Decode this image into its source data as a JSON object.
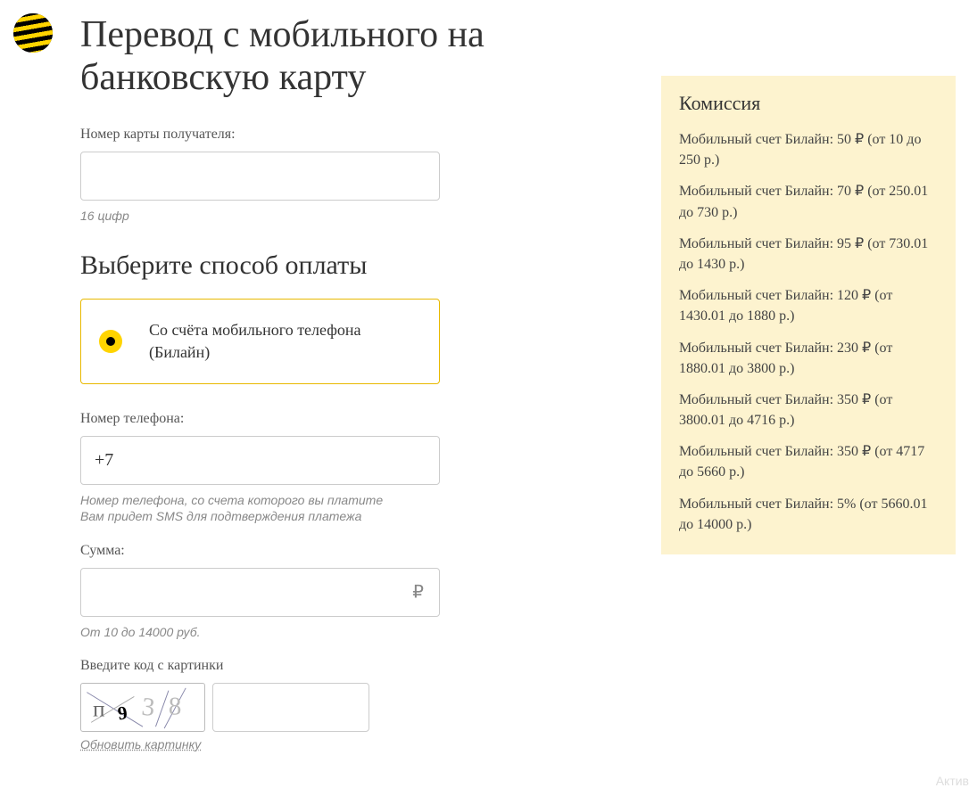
{
  "page_title": "Перевод с мобильного на банковскую карту",
  "card": {
    "label": "Номер карты получателя:",
    "value": "",
    "hint": "16 цифр"
  },
  "payment_method": {
    "heading": "Выберите способ оплаты",
    "option_label": "Со счёта мобильного телефона (Билайн)"
  },
  "phone": {
    "label": "Номер телефона:",
    "value": "+7",
    "hint_line1": "Номер телефона, со счета которого вы платите",
    "hint_line2": "Вам придет SMS для подтверждения платежа"
  },
  "amount": {
    "label": "Сумма:",
    "value": "",
    "currency": "₽",
    "hint": "От 10 до 14000 руб."
  },
  "captcha": {
    "label": "Введите код с картинки",
    "value": "",
    "refresh": "Обновить картинку"
  },
  "commission": {
    "title": "Комиссия",
    "items": [
      "Мобильный счет Билайн: 50 ₽ (от 10 до 250 р.)",
      "Мобильный счет Билайн: 70 ₽ (от 250.01 до 730 р.)",
      "Мобильный счет Билайн: 95 ₽ (от 730.01 до 1430 р.)",
      "Мобильный счет Билайн: 120 ₽ (от 1430.01 до 1880 р.)",
      "Мобильный счет Билайн: 230 ₽ (от 1880.01 до 3800 р.)",
      "Мобильный счет Билайн: 350 ₽ (от 3800.01 до 4716 р.)",
      "Мобильный счет Билайн: 350 ₽ (от 4717 до 5660 р.)",
      "Мобильный счет Билайн: 5% (от 5660.01 до 14000 р.)"
    ]
  },
  "watermark": "Актив"
}
